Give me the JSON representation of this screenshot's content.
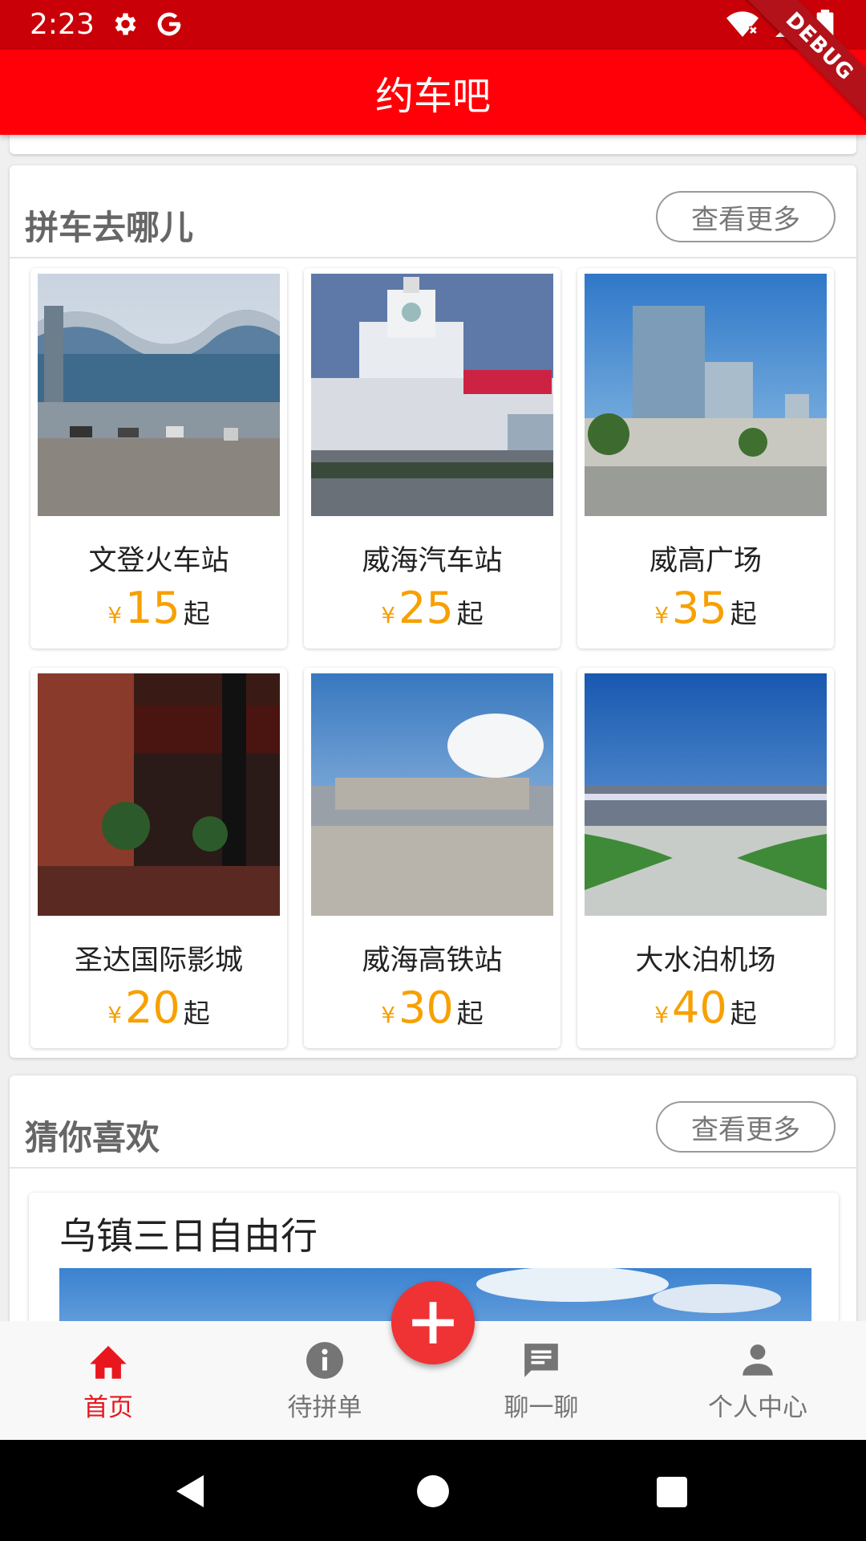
{
  "status": {
    "time": "2:23",
    "debug_label": "DEBUG"
  },
  "app_bar": {
    "title": "约车吧"
  },
  "carpool_section": {
    "title": "拼车去哪儿",
    "more_label": "查看更多",
    "destinations": [
      {
        "name": "文登火车站",
        "currency": "¥",
        "price": "15",
        "suffix": "起",
        "photo": "station-photo"
      },
      {
        "name": "威海汽车站",
        "currency": "¥",
        "price": "25",
        "suffix": "起",
        "photo": "bus-station-photo"
      },
      {
        "name": "威高广场",
        "currency": "¥",
        "price": "35",
        "suffix": "起",
        "photo": "plaza-photo"
      },
      {
        "name": "圣达国际影城",
        "currency": "¥",
        "price": "20",
        "suffix": "起",
        "photo": "cinema-photo"
      },
      {
        "name": "威海高铁站",
        "currency": "¥",
        "price": "30",
        "suffix": "起",
        "photo": "rail-station-photo"
      },
      {
        "name": "大水泊机场",
        "currency": "¥",
        "price": "40",
        "suffix": "起",
        "photo": "airport-photo"
      }
    ]
  },
  "guess_section": {
    "title": "猜你喜欢",
    "more_label": "查看更多",
    "items": [
      {
        "title": "乌镇三日自由行"
      }
    ]
  },
  "bottom_nav": {
    "items": [
      {
        "label": "首页",
        "icon": "home-icon",
        "active": true
      },
      {
        "label": "待拼单",
        "icon": "info-icon",
        "active": false
      },
      {
        "label": "聊一聊",
        "icon": "chat-icon",
        "active": false
      },
      {
        "label": "个人中心",
        "icon": "person-icon",
        "active": false
      }
    ],
    "fab_icon": "plus-icon"
  },
  "colors": {
    "status_bar": "#c90008",
    "app_bar": "#ff0008",
    "price": "#f7a000",
    "nav_active": "#e8171e",
    "nav_inactive": "#757575",
    "fab": "#ef3234"
  }
}
